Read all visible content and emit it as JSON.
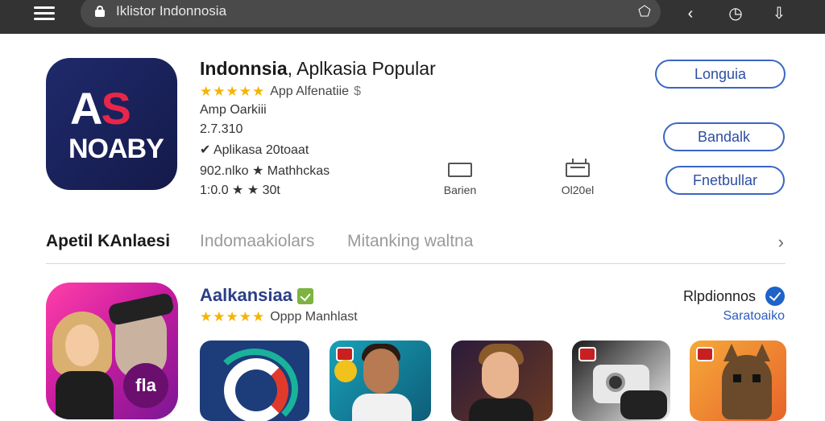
{
  "browser": {
    "address": "Iklistor Indonnosia"
  },
  "hero": {
    "title_bold": "Indonnsia",
    "title_rest": ", Aplkasia Popular",
    "icon_line1_a": "A",
    "icon_line1_b": "S",
    "icon_line2": "NOABY",
    "stars": "★★★★★",
    "rating_label": "App Alfenatiie",
    "currency": "$",
    "developer": "Amp Oarkiii",
    "version": "2.7.310",
    "category": "Aplikasa 20toaat",
    "downloads": "902.nlko",
    "downloads_extra": "Mathhckas",
    "rating_num": "1:0.0",
    "rating_extra": "30t",
    "mini1_label": "Barien",
    "mini2_label": "Ol20el",
    "buttons": {
      "primary": "Longuia",
      "secondary": "Bandalk",
      "tertiary": "Fnetbullar"
    }
  },
  "tabs": {
    "active": "Apetil KAnlaesi",
    "tab2": "Indomaakiolars",
    "tab3": "Mitanking   waltna",
    "arrow": "›"
  },
  "featured": {
    "title": "Aalkansiaa",
    "stars": "★★★★★",
    "rating_label": "Oppp Manhlast",
    "side_label": "Rlpdionnos",
    "side_link": "Saratoaiko",
    "icon_text": "fla"
  },
  "colors": {
    "accent": "#2d4fa3",
    "star": "#f5b400",
    "topbar": "#333333"
  },
  "icons": [
    "menu-icon",
    "lock-icon",
    "pentagon-icon",
    "back-icon",
    "clock-icon",
    "share-icon",
    "calendar-icon",
    "monitor-icon",
    "chevron-right-icon",
    "check-badge-icon"
  ]
}
